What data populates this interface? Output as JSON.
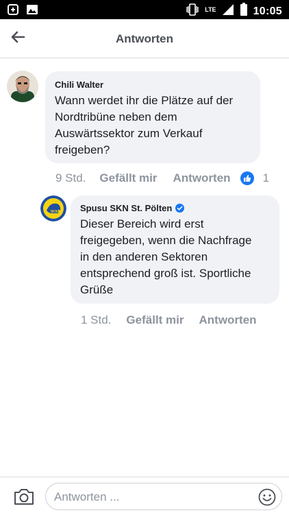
{
  "status_bar": {
    "network": "LTE",
    "time": "10:05"
  },
  "header": {
    "title": "Antworten"
  },
  "comment": {
    "author": "Chili Walter",
    "text_lines": [
      "Wann werdet ihr die Plätze auf der",
      "Nordtribüne neben dem",
      "Auswärtssektor zum Verkauf",
      "freigeben?"
    ],
    "time": "9 Std.",
    "like_label": "Gefällt mir",
    "reply_label": "Antworten",
    "like_count": "1"
  },
  "reply": {
    "author": "Spusu SKN St. Pölten",
    "verified": true,
    "text_lines": [
      "Dieser Bereich wird erst",
      "freigegeben, wenn die Nachfrage",
      "in den anderen Sektoren",
      "entsprechend groß ist. Sportliche",
      "Grüße"
    ],
    "time": "1 Std.",
    "like_label": "Gefällt mir",
    "reply_label": "Antworten"
  },
  "composer": {
    "placeholder": "Antworten ..."
  },
  "colors": {
    "brand_blue": "#1877f2",
    "bubble": "#f0f2f5",
    "muted": "#8d949e",
    "skn_yellow": "#f5d313",
    "skn_blue": "#1f4fa3"
  }
}
